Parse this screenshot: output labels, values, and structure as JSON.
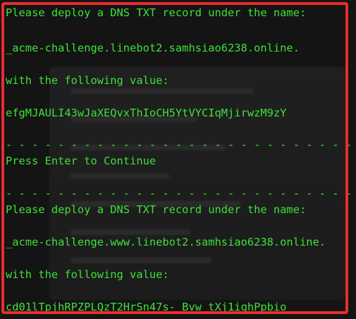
{
  "colors": {
    "terminal_text": "#3ee03a",
    "background": "#141414",
    "highlight_border": "#ea2c2c"
  },
  "terminal": {
    "lines": [
      "Please deploy a DNS TXT record under the name:",
      "_acme-challenge.linebot2.samhsiao6238.online.",
      "with the following value:",
      "efgMJAULI43wJaXEQvxThIoCH5YtVYCIqMjirwzM9zY",
      "- - - - - - - - - - - - - - - - - - - - - - - - - - - - - - - - - - - - - - - -",
      "Press Enter to Continue",
      "- - - - - - - - - - - - - - - - - - - - - - - - - - - - - - - - - - - - - - - -",
      "Please deploy a DNS TXT record under the name:",
      "_acme-challenge.www.linebot2.samhsiao6238.online.",
      "with the following value:",
      "cd01lTpjhRPZPLQzT2HrSn47s-_Bvw_tXj1ighPpbio"
    ]
  }
}
